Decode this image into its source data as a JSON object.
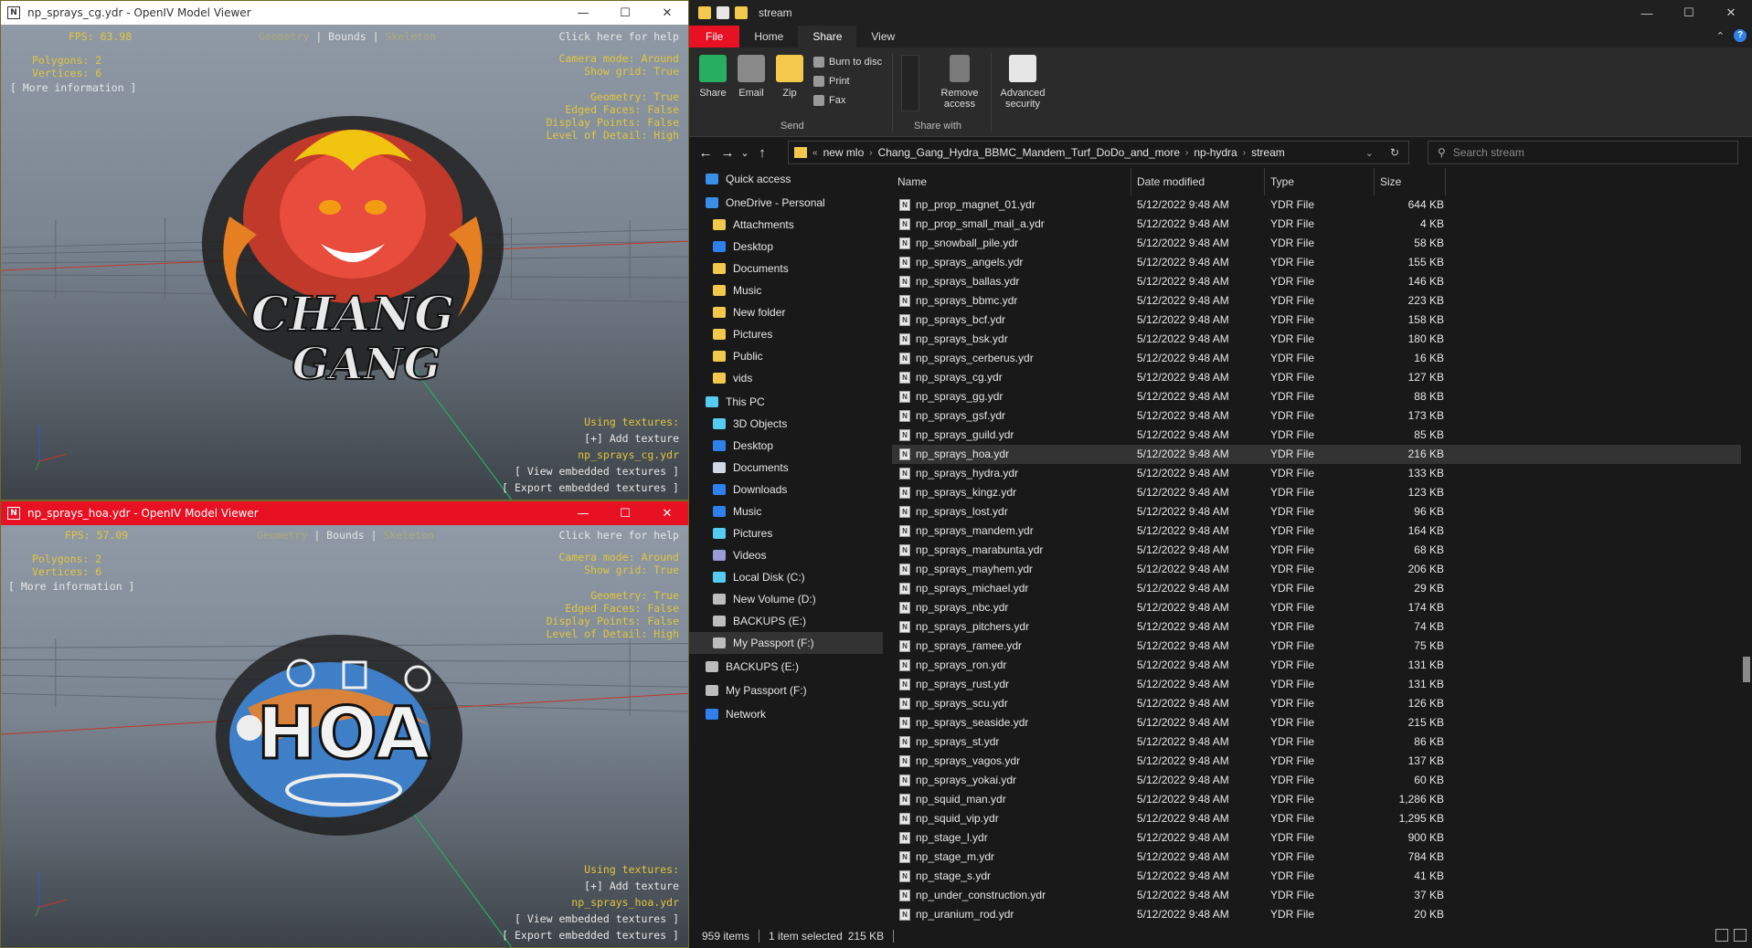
{
  "viewer_top": {
    "title": "np_sprays_cg.ydr - OpenIV Model Viewer",
    "app_icon": "N",
    "fps": "FPS: 63.98",
    "modes": {
      "geometry": "Geometry",
      "sep1": " | ",
      "bounds": "Bounds",
      "sep2": " | ",
      "skeleton": "Skeleton"
    },
    "help": "Click here for help",
    "polygons": "Polygons: 2",
    "vertices": "Vertices: 6",
    "more_info": "[ More information ]",
    "camera": "Camera mode: Around",
    "show_grid": "Show grid: True",
    "geometry_line": "Geometry: True",
    "edged": "Edged Faces: False",
    "display_points": "Display Points: False",
    "lod": "Level of Detail: High",
    "using_textures": "Using textures:",
    "add_texture": "[+] Add texture",
    "texture_file": "np_sprays_cg.ydr",
    "view_embedded": "[ View embedded textures ]",
    "export_embedded": "[ Export embedded textures ]",
    "spray_text_1": "CHANG",
    "spray_text_2": "GANG"
  },
  "viewer_bottom": {
    "title": "np_sprays_hoa.ydr - OpenIV Model Viewer",
    "app_icon": "N",
    "fps": "FPS: 57.09",
    "modes": {
      "geometry": "Geometry",
      "sep1": " | ",
      "bounds": "Bounds",
      "sep2": " | ",
      "skeleton": "Skeleton"
    },
    "help": "Click here for help",
    "polygons": "Polygons: 2",
    "vertices": "Vertices: 6",
    "more_info": "[ More information ]",
    "camera": "Camera mode: Around",
    "show_grid": "Show grid: True",
    "geometry_line": "Geometry: True",
    "edged": "Edged Faces: False",
    "display_points": "Display Points: False",
    "lod": "Level of Detail: High",
    "using_textures": "Using textures:",
    "add_texture": "[+] Add texture",
    "texture_file": "np_sprays_hoa.ydr",
    "view_embedded": "[ View embedded textures ]",
    "export_embedded": "[ Export embedded textures ]",
    "spray_text": "HOA"
  },
  "window_controls": {
    "minimize": "—",
    "maximize": "☐",
    "close": "✕"
  },
  "explorer": {
    "title": "stream",
    "tabs": {
      "file": "File",
      "home": "Home",
      "share": "Share",
      "view": "View"
    },
    "ribbon": {
      "share": "Share",
      "email": "Email",
      "zip": "Zip",
      "burn": "Burn to disc",
      "print": "Print",
      "fax": "Fax",
      "send_group": "Send",
      "remove_access_1": "Remove",
      "remove_access_2": "access",
      "share_with_group": "Share with",
      "advanced_1": "Advanced",
      "advanced_2": "security"
    },
    "nav": {
      "back": "←",
      "forward": "→",
      "recent": "⌄",
      "up": "↑"
    },
    "breadcrumb": [
      "new mlo",
      "Chang_Gang_Hydra_BBMC_Mandem_Turf_DoDo_and_more",
      "np-hydra",
      "stream"
    ],
    "breadcrumb_lead": "«",
    "search_placeholder": "Search stream",
    "columns": {
      "name": "Name",
      "date": "Date modified",
      "type": "Type",
      "size": "Size"
    },
    "nav_pane": [
      {
        "label": "Quick access",
        "indent": 0,
        "icon": "star-icon",
        "color": "#3a8ee6"
      },
      {
        "label": "OneDrive - Personal",
        "indent": 0,
        "icon": "cloud-icon",
        "color": "#3a8ee6"
      },
      {
        "label": "Attachments",
        "indent": 1,
        "icon": "folder-icon",
        "color": "#f2c94c"
      },
      {
        "label": "Desktop",
        "indent": 1,
        "icon": "desktop-icon",
        "color": "#2f80ed"
      },
      {
        "label": "Documents",
        "indent": 1,
        "icon": "folder-icon",
        "color": "#f2c94c"
      },
      {
        "label": "Music",
        "indent": 1,
        "icon": "folder-icon",
        "color": "#f2c94c"
      },
      {
        "label": "New folder",
        "indent": 1,
        "icon": "folder-icon",
        "color": "#f2c94c"
      },
      {
        "label": "Pictures",
        "indent": 1,
        "icon": "folder-icon",
        "color": "#f2c94c"
      },
      {
        "label": "Public",
        "indent": 1,
        "icon": "folder-icon",
        "color": "#f2c94c"
      },
      {
        "label": "vids",
        "indent": 1,
        "icon": "folder-icon",
        "color": "#f2c94c"
      },
      {
        "label": "This PC",
        "indent": 0,
        "icon": "pc-icon",
        "color": "#56ccf2"
      },
      {
        "label": "3D Objects",
        "indent": 1,
        "icon": "cube-icon",
        "color": "#56ccf2"
      },
      {
        "label": "Desktop",
        "indent": 1,
        "icon": "desktop-icon",
        "color": "#2f80ed"
      },
      {
        "label": "Documents",
        "indent": 1,
        "icon": "document-icon",
        "color": "#cfd8e3"
      },
      {
        "label": "Downloads",
        "indent": 1,
        "icon": "download-icon",
        "color": "#2f80ed"
      },
      {
        "label": "Music",
        "indent": 1,
        "icon": "music-icon",
        "color": "#2f80ed"
      },
      {
        "label": "Pictures",
        "indent": 1,
        "icon": "pictures-icon",
        "color": "#56ccf2"
      },
      {
        "label": "Videos",
        "indent": 1,
        "icon": "video-icon",
        "color": "#9b9bd6"
      },
      {
        "label": "Local Disk (C:)",
        "indent": 1,
        "icon": "disk-icon",
        "color": "#56ccf2"
      },
      {
        "label": "New Volume (D:)",
        "indent": 1,
        "icon": "drive-icon",
        "color": "#bdbdbd"
      },
      {
        "label": "BACKUPS (E:)",
        "indent": 1,
        "icon": "drive-icon",
        "color": "#bdbdbd"
      },
      {
        "label": "My Passport (F:)",
        "indent": 1,
        "icon": "drive-icon",
        "color": "#bdbdbd",
        "selected": true
      },
      {
        "label": "BACKUPS (E:)",
        "indent": 0,
        "icon": "drive-icon",
        "color": "#bdbdbd"
      },
      {
        "label": "My Passport (F:)",
        "indent": 0,
        "icon": "drive-icon",
        "color": "#bdbdbd"
      },
      {
        "label": "Network",
        "indent": 0,
        "icon": "network-icon",
        "color": "#2f80ed"
      }
    ],
    "files": [
      {
        "name": "np_prop_magnet_01.ydr",
        "date": "5/12/2022 9:48 AM",
        "type": "YDR File",
        "size": "644 KB"
      },
      {
        "name": "np_prop_small_mail_a.ydr",
        "date": "5/12/2022 9:48 AM",
        "type": "YDR File",
        "size": "4 KB"
      },
      {
        "name": "np_snowball_pile.ydr",
        "date": "5/12/2022 9:48 AM",
        "type": "YDR File",
        "size": "58 KB"
      },
      {
        "name": "np_sprays_angels.ydr",
        "date": "5/12/2022 9:48 AM",
        "type": "YDR File",
        "size": "155 KB"
      },
      {
        "name": "np_sprays_ballas.ydr",
        "date": "5/12/2022 9:48 AM",
        "type": "YDR File",
        "size": "146 KB"
      },
      {
        "name": "np_sprays_bbmc.ydr",
        "date": "5/12/2022 9:48 AM",
        "type": "YDR File",
        "size": "223 KB"
      },
      {
        "name": "np_sprays_bcf.ydr",
        "date": "5/12/2022 9:48 AM",
        "type": "YDR File",
        "size": "158 KB"
      },
      {
        "name": "np_sprays_bsk.ydr",
        "date": "5/12/2022 9:48 AM",
        "type": "YDR File",
        "size": "180 KB"
      },
      {
        "name": "np_sprays_cerberus.ydr",
        "date": "5/12/2022 9:48 AM",
        "type": "YDR File",
        "size": "16 KB"
      },
      {
        "name": "np_sprays_cg.ydr",
        "date": "5/12/2022 9:48 AM",
        "type": "YDR File",
        "size": "127 KB"
      },
      {
        "name": "np_sprays_gg.ydr",
        "date": "5/12/2022 9:48 AM",
        "type": "YDR File",
        "size": "88 KB"
      },
      {
        "name": "np_sprays_gsf.ydr",
        "date": "5/12/2022 9:48 AM",
        "type": "YDR File",
        "size": "173 KB"
      },
      {
        "name": "np_sprays_guild.ydr",
        "date": "5/12/2022 9:48 AM",
        "type": "YDR File",
        "size": "85 KB"
      },
      {
        "name": "np_sprays_hoa.ydr",
        "date": "5/12/2022 9:48 AM",
        "type": "YDR File",
        "size": "216 KB",
        "selected": true
      },
      {
        "name": "np_sprays_hydra.ydr",
        "date": "5/12/2022 9:48 AM",
        "type": "YDR File",
        "size": "133 KB"
      },
      {
        "name": "np_sprays_kingz.ydr",
        "date": "5/12/2022 9:48 AM",
        "type": "YDR File",
        "size": "123 KB"
      },
      {
        "name": "np_sprays_lost.ydr",
        "date": "5/12/2022 9:48 AM",
        "type": "YDR File",
        "size": "96 KB"
      },
      {
        "name": "np_sprays_mandem.ydr",
        "date": "5/12/2022 9:48 AM",
        "type": "YDR File",
        "size": "164 KB"
      },
      {
        "name": "np_sprays_marabunta.ydr",
        "date": "5/12/2022 9:48 AM",
        "type": "YDR File",
        "size": "68 KB"
      },
      {
        "name": "np_sprays_mayhem.ydr",
        "date": "5/12/2022 9:48 AM",
        "type": "YDR File",
        "size": "206 KB"
      },
      {
        "name": "np_sprays_michael.ydr",
        "date": "5/12/2022 9:48 AM",
        "type": "YDR File",
        "size": "29 KB"
      },
      {
        "name": "np_sprays_nbc.ydr",
        "date": "5/12/2022 9:48 AM",
        "type": "YDR File",
        "size": "174 KB"
      },
      {
        "name": "np_sprays_pitchers.ydr",
        "date": "5/12/2022 9:48 AM",
        "type": "YDR File",
        "size": "74 KB"
      },
      {
        "name": "np_sprays_ramee.ydr",
        "date": "5/12/2022 9:48 AM",
        "type": "YDR File",
        "size": "75 KB"
      },
      {
        "name": "np_sprays_ron.ydr",
        "date": "5/12/2022 9:48 AM",
        "type": "YDR File",
        "size": "131 KB"
      },
      {
        "name": "np_sprays_rust.ydr",
        "date": "5/12/2022 9:48 AM",
        "type": "YDR File",
        "size": "131 KB"
      },
      {
        "name": "np_sprays_scu.ydr",
        "date": "5/12/2022 9:48 AM",
        "type": "YDR File",
        "size": "126 KB"
      },
      {
        "name": "np_sprays_seaside.ydr",
        "date": "5/12/2022 9:48 AM",
        "type": "YDR File",
        "size": "215 KB"
      },
      {
        "name": "np_sprays_st.ydr",
        "date": "5/12/2022 9:48 AM",
        "type": "YDR File",
        "size": "86 KB"
      },
      {
        "name": "np_sprays_vagos.ydr",
        "date": "5/12/2022 9:48 AM",
        "type": "YDR File",
        "size": "137 KB"
      },
      {
        "name": "np_sprays_yokai.ydr",
        "date": "5/12/2022 9:48 AM",
        "type": "YDR File",
        "size": "60 KB"
      },
      {
        "name": "np_squid_man.ydr",
        "date": "5/12/2022 9:48 AM",
        "type": "YDR File",
        "size": "1,286 KB"
      },
      {
        "name": "np_squid_vip.ydr",
        "date": "5/12/2022 9:48 AM",
        "type": "YDR File",
        "size": "1,295 KB"
      },
      {
        "name": "np_stage_l.ydr",
        "date": "5/12/2022 9:48 AM",
        "type": "YDR File",
        "size": "900 KB"
      },
      {
        "name": "np_stage_m.ydr",
        "date": "5/12/2022 9:48 AM",
        "type": "YDR File",
        "size": "784 KB"
      },
      {
        "name": "np_stage_s.ydr",
        "date": "5/12/2022 9:48 AM",
        "type": "YDR File",
        "size": "41 KB"
      },
      {
        "name": "np_under_construction.ydr",
        "date": "5/12/2022 9:48 AM",
        "type": "YDR File",
        "size": "37 KB"
      },
      {
        "name": "np_uranium_rod.ydr",
        "date": "5/12/2022 9:48 AM",
        "type": "YDR File",
        "size": "20 KB"
      }
    ],
    "status": {
      "items": "959 items",
      "selected": "1 item selected",
      "selected_size": "215 KB"
    }
  }
}
